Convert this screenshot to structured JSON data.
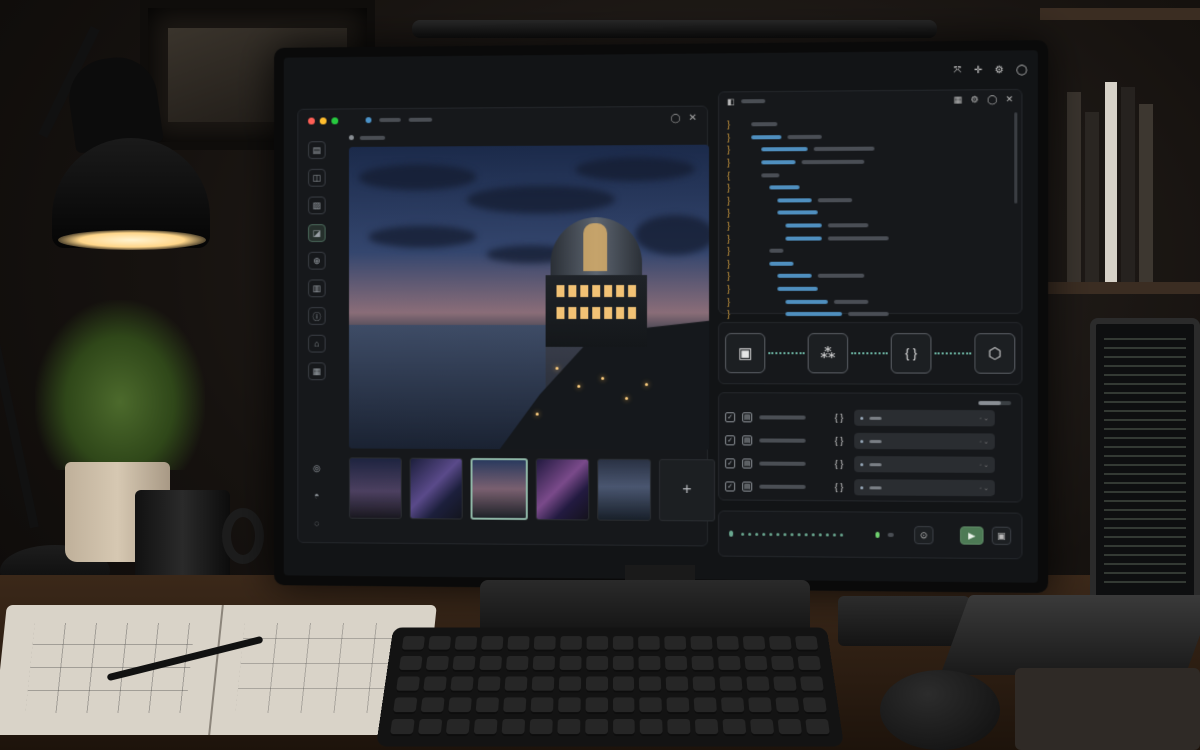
{
  "scene": {
    "colors": {
      "accent": "#6ab1a0",
      "play": "#4d7a55",
      "brace": "#d9a441",
      "code_blue": "#4f8fbf",
      "traffic_red": "#ff5f56",
      "traffic_yellow": "#ffbd2e",
      "traffic_green": "#27c93f"
    }
  },
  "window": {
    "system_icons": [
      "expand-icon",
      "crosshair-icon",
      "settings-icon",
      "power-icon"
    ]
  },
  "left_panel": {
    "rail_icons": [
      "document-icon",
      "layers-icon",
      "image-icon",
      "chart-icon",
      "upload-icon",
      "layout-icon",
      "info-icon",
      "home-icon",
      "grid-icon",
      "globe-icon",
      "user-icon",
      "help-icon"
    ],
    "viewer_controls": [
      "refresh-icon",
      "close-icon"
    ],
    "thumbnails": [
      "observatory-night",
      "starry-ridge",
      "observatory-dusk",
      "milky-way-valley",
      "coastal-night"
    ],
    "add_label": "+"
  },
  "code_panel": {
    "controls": [
      "pin-icon",
      "settings-icon",
      "refresh-icon",
      "close-icon"
    ],
    "braces": [
      "}",
      "}",
      "}",
      "}",
      "{",
      "}",
      "}",
      "}",
      "}",
      "}",
      "}",
      "}",
      "}",
      "}",
      "}",
      "}",
      "}",
      "}",
      "}",
      "}",
      "}"
    ]
  },
  "pipeline": {
    "nodes": [
      {
        "icon": "image-icon",
        "glyph": "▣"
      },
      {
        "icon": "network-icon",
        "glyph": "⁂"
      },
      {
        "icon": "braces-icon",
        "glyph": "{ }"
      },
      {
        "icon": "cube-icon",
        "glyph": "⬡"
      }
    ]
  },
  "mapping_list": {
    "brace_label": "{ }",
    "rows": 4
  },
  "controls": {
    "play_glyph": "▶"
  }
}
